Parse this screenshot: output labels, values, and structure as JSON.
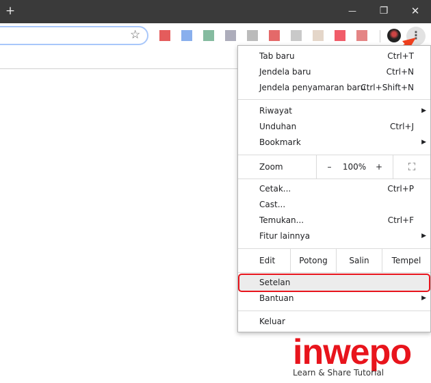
{
  "window": {
    "new_tab": "+",
    "minimize": "—",
    "restore": "❐",
    "close": "✕"
  },
  "toolbar": {
    "bookmark": "☆",
    "menu": "⋮"
  },
  "extensions": [
    "#d33",
    "#6c9be8",
    "#6a8",
    "#99a",
    "#aaa",
    "#d44",
    "#bbb",
    "#dcb",
    "#e34",
    "#d66"
  ],
  "menu": {
    "items_top": [
      {
        "label": "Tab baru",
        "shortcut": "Ctrl+T"
      },
      {
        "label": "Jendela baru",
        "shortcut": "Ctrl+N"
      },
      {
        "label": "Jendela penyamaran baru",
        "shortcut": "Ctrl+Shift+N"
      }
    ],
    "items_mid": [
      {
        "label": "Riwayat",
        "arrow": "▶"
      },
      {
        "label": "Unduhan",
        "shortcut": "Ctrl+J"
      },
      {
        "label": "Bookmark",
        "arrow": "▶"
      }
    ],
    "zoom": {
      "label": "Zoom",
      "minus": "–",
      "value": "100%",
      "plus": "+",
      "fullscreen": "⛶"
    },
    "items_tools": [
      {
        "label": "Cetak...",
        "shortcut": "Ctrl+P"
      },
      {
        "label": "Cast..."
      },
      {
        "label": "Temukan...",
        "shortcut": "Ctrl+F"
      },
      {
        "label": "Fitur lainnya",
        "arrow": "▶"
      }
    ],
    "edit": {
      "label": "Edit",
      "cut": "Potong",
      "copy": "Salin",
      "paste": "Tempel"
    },
    "settings": "Setelan",
    "help": {
      "label": "Bantuan",
      "arrow": "▶"
    },
    "exit": "Keluar"
  },
  "logo": {
    "name": "inwepo",
    "tagline": "Learn & Share Tutorial"
  }
}
